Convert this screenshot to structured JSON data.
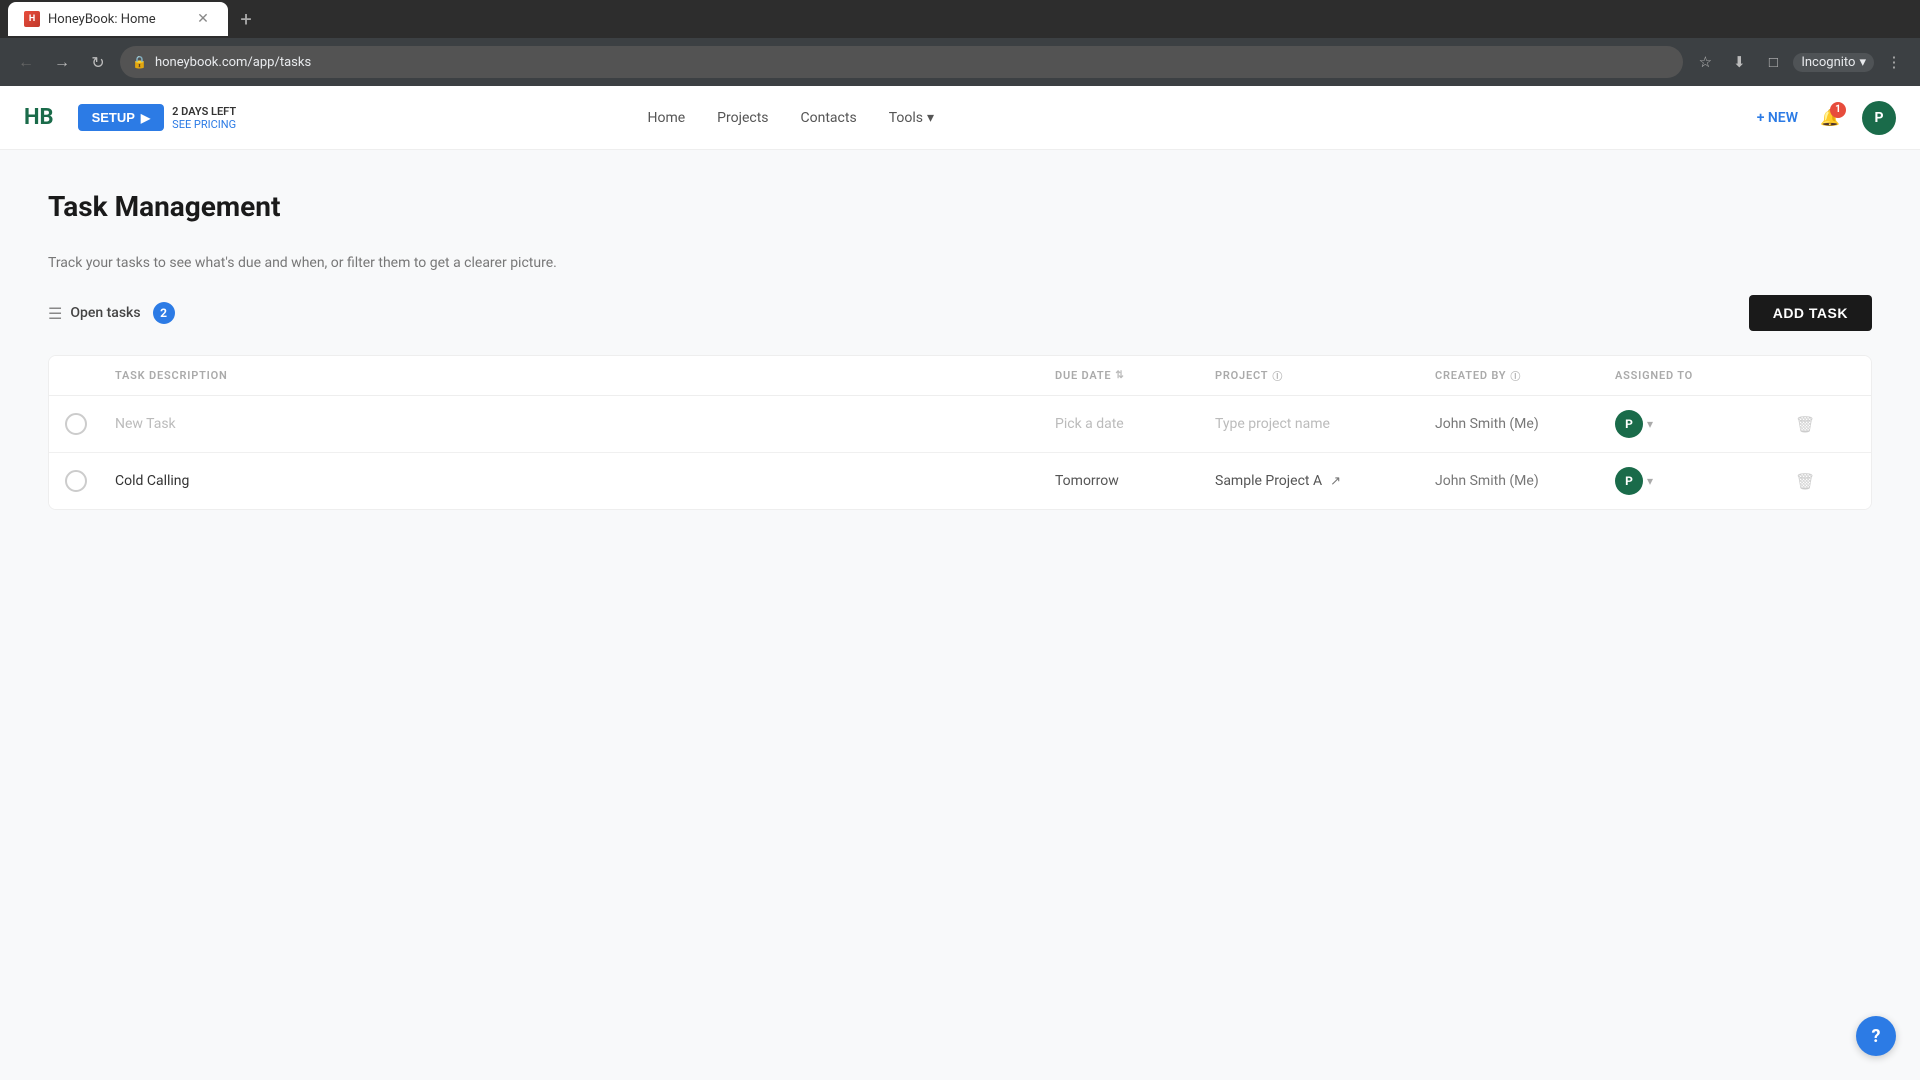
{
  "browser": {
    "tab_title": "HoneyBook: Home",
    "url": "honeybook.com/app/tasks",
    "favicon_text": "HB",
    "incognito_label": "Incognito"
  },
  "nav": {
    "logo": "HB",
    "setup_label": "SETUP",
    "trial_days": "2 DAYS LEFT",
    "see_pricing": "SEE PRICING",
    "links": [
      "Home",
      "Projects",
      "Contacts"
    ],
    "tools_label": "Tools",
    "new_label": "+ NEW",
    "notif_count": "1",
    "avatar_letter": "P"
  },
  "page": {
    "title": "Task Management",
    "description": "Track your tasks to see what's due and when, or filter them to get a clearer picture.",
    "filter_label": "Open tasks",
    "task_count": "2",
    "add_task_label": "ADD TASK"
  },
  "table": {
    "columns": {
      "task_desc": "TASK DESCRIPTION",
      "due_date": "DUE DATE",
      "project": "PROJECT",
      "created_by": "CREATED BY",
      "assigned_to": "ASSIGNED TO"
    },
    "rows": [
      {
        "id": 1,
        "task_desc": "New Task",
        "task_desc_placeholder": true,
        "due_date": "Pick a date",
        "due_date_placeholder": true,
        "project": "Type project name",
        "project_placeholder": true,
        "created_by": "John Smith (Me)",
        "assignee_letter": "P",
        "has_link": false
      },
      {
        "id": 2,
        "task_desc": "Cold Calling",
        "task_desc_placeholder": false,
        "due_date": "Tomorrow",
        "due_date_placeholder": false,
        "project": "Sample Project A",
        "project_placeholder": false,
        "created_by": "John Smith (Me)",
        "assignee_letter": "P",
        "has_link": true
      }
    ]
  },
  "help": {
    "label": "?"
  }
}
